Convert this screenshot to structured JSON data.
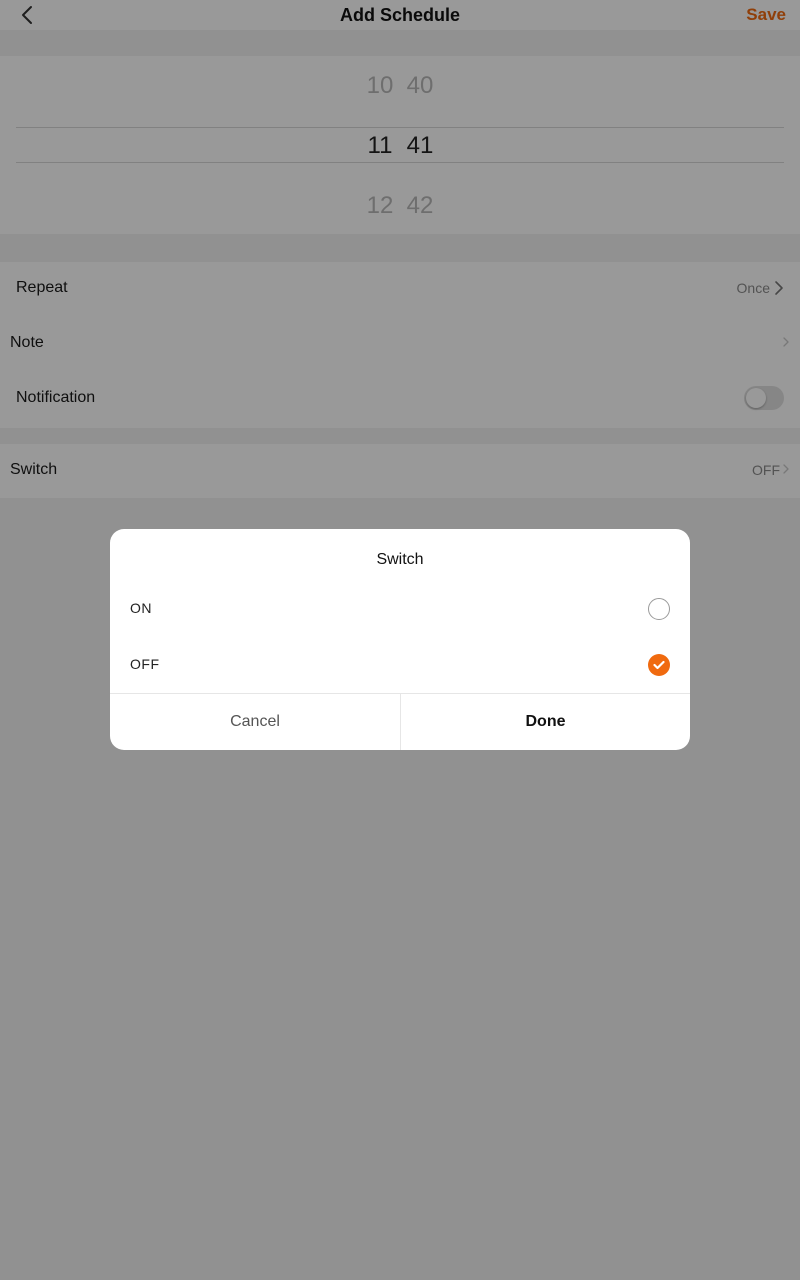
{
  "header": {
    "title": "Add Schedule",
    "save_label": "Save",
    "back_icon": "chevron-left-icon"
  },
  "colors": {
    "accent": "#f06a0f"
  },
  "picker": {
    "hours": [
      "10",
      "11",
      "12"
    ],
    "minutes": [
      "40",
      "41",
      "42"
    ],
    "selected_hour": "11",
    "selected_minute": "41"
  },
  "settings": {
    "repeat": {
      "label": "Repeat",
      "value": "Once"
    },
    "note": {
      "label": "Note"
    },
    "notification": {
      "label": "Notification",
      "enabled": false
    },
    "switch": {
      "label": "Switch",
      "value": "OFF"
    }
  },
  "dialog": {
    "title": "Switch",
    "options": [
      {
        "label": "ON",
        "selected": false
      },
      {
        "label": "OFF",
        "selected": true
      }
    ],
    "cancel_label": "Cancel",
    "done_label": "Done"
  }
}
